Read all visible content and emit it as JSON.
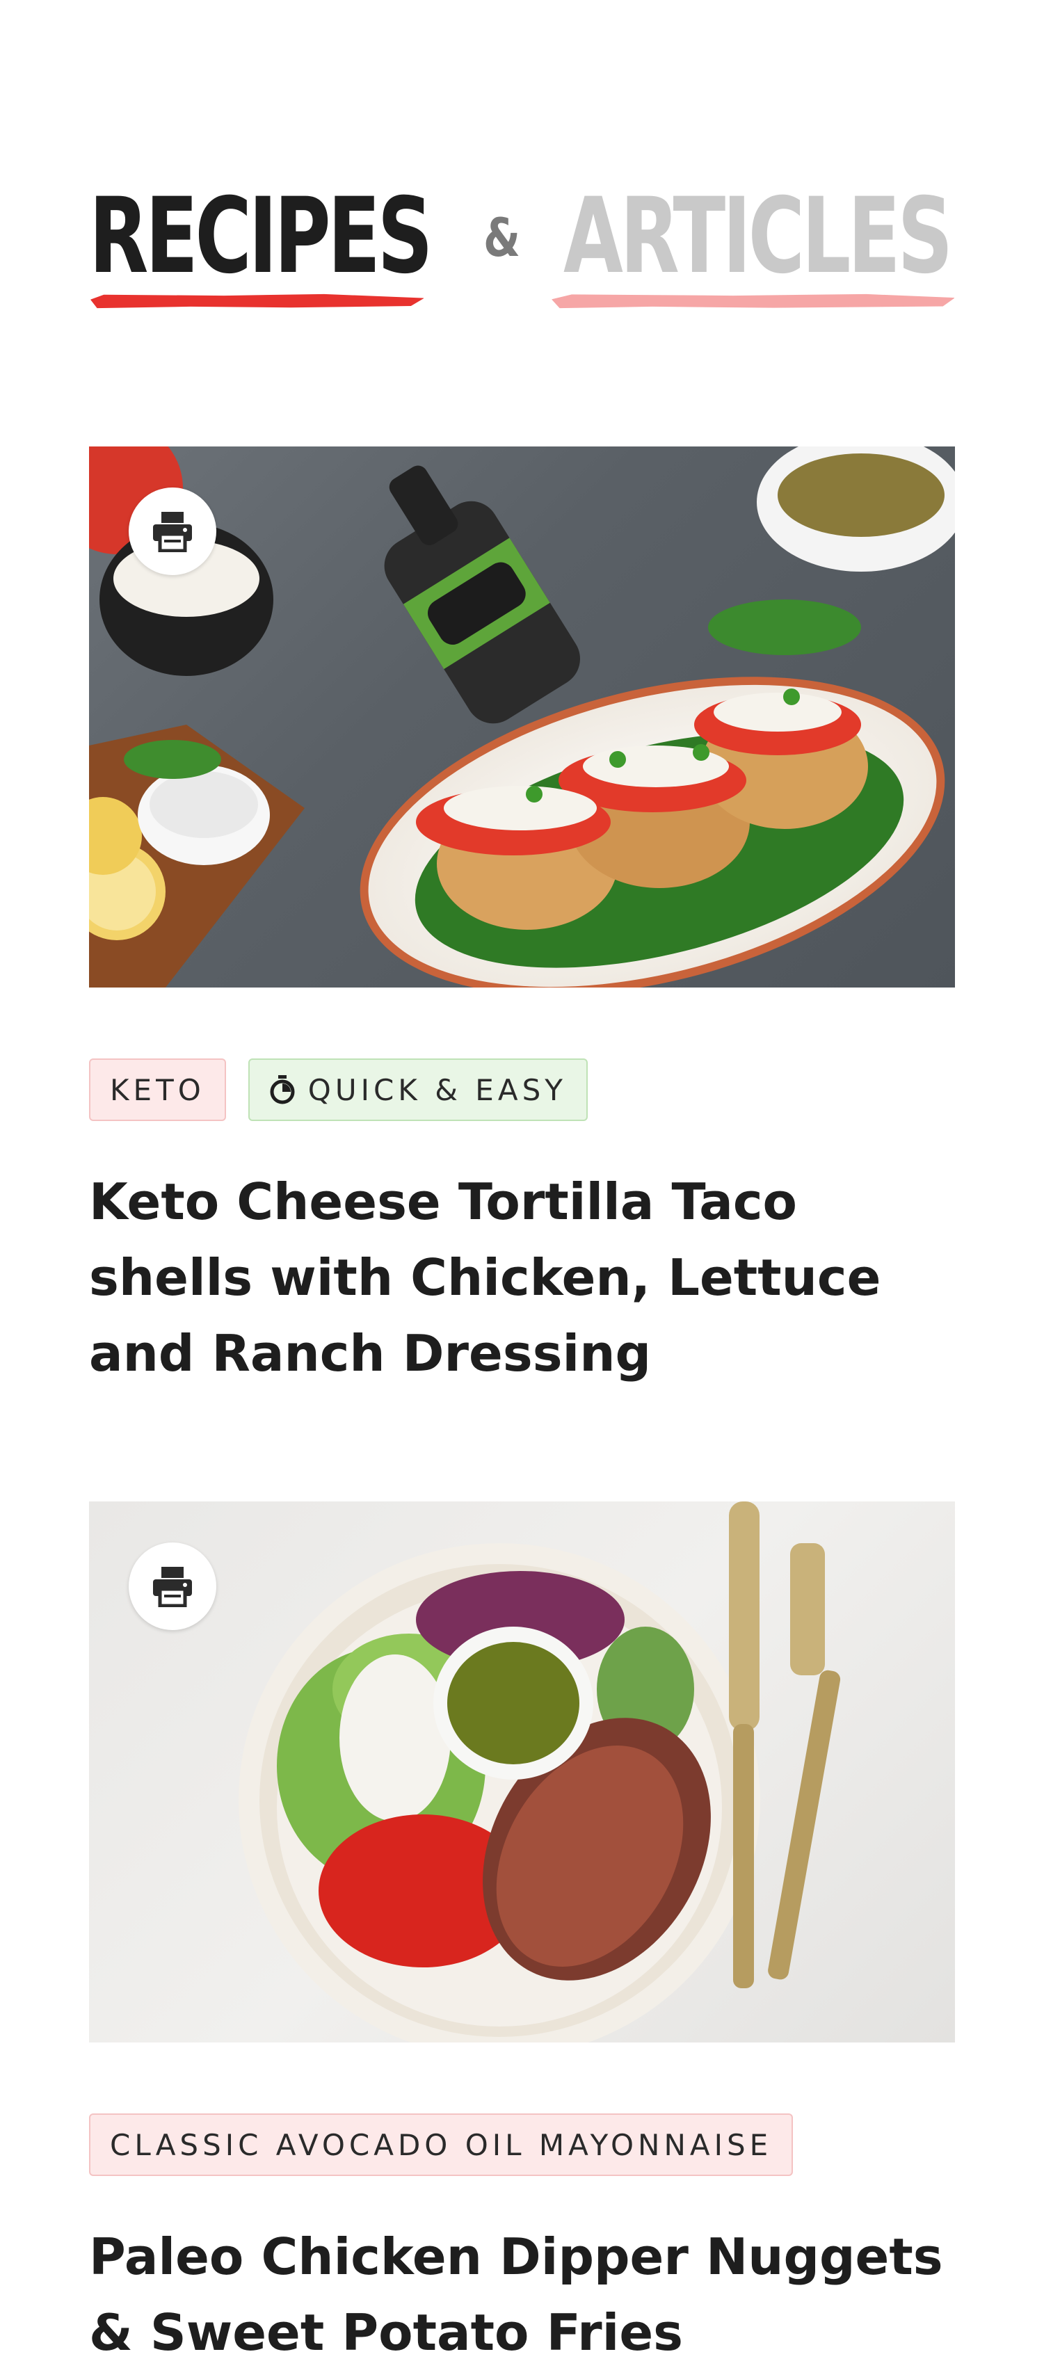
{
  "header": {
    "tab_recipes": "RECIPES",
    "ampersand": "&",
    "tab_articles": "ARTICLES",
    "active_tab": "RECIPES",
    "colors": {
      "active": "#1e1e1e",
      "inactive": "#c9c9c9",
      "accent": "#e8322e",
      "accent_light": "#f6a6a6"
    }
  },
  "cards": [
    {
      "image_alt": "Chicken thighs topped with tomato and feta on greens with avocado oil bottle",
      "print_icon": "printer-icon",
      "tags": [
        {
          "label": "KETO",
          "style": "pink"
        },
        {
          "label": "QUICK & EASY",
          "style": "green",
          "icon": "timer-icon"
        }
      ],
      "title": "Keto Cheese Tortilla Taco shells with Chicken, Lettuce and Ranch Dressing"
    },
    {
      "image_alt": "Bowl of chopped salad with sliced steak, feta and dressing, with knife and fork",
      "print_icon": "printer-icon",
      "tags": [
        {
          "label": "CLASSIC AVOCADO OIL MAYONNAISE",
          "style": "pink"
        }
      ],
      "title": "Paleo Chicken Dipper Nuggets & Sweet Potato Fries"
    }
  ]
}
